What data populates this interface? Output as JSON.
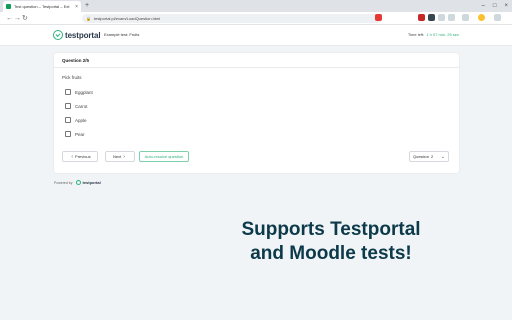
{
  "browser": {
    "tab_title": "Test question – Testportal – Ext",
    "tab_close": "×",
    "new_tab": "+",
    "window_buttons": [
      "–",
      "□",
      "×"
    ],
    "nav_icons": [
      "←",
      "→",
      "↻"
    ],
    "url": "testportal.pl/exam/LoadQuestion.html"
  },
  "header": {
    "logo_text": "testportal",
    "test_name": "Example test: Fruits",
    "time_label": "Time left:",
    "time_value": "1 h 07 min. 25 sec"
  },
  "question": {
    "title": "Question 2/5",
    "prompt": "Pick fruits",
    "options": [
      "Eggplant",
      "Carrot",
      "Apple",
      "Pear"
    ],
    "previous_label": "Previous",
    "next_label": "Next",
    "auto_label": "Auto-resolve question",
    "selector_label": "Question",
    "selector_value": "2"
  },
  "footer": {
    "powered_label": "Powered by",
    "powered_name": "testportal"
  },
  "promo": {
    "line1": "Supports Testportal",
    "line2": "and Moodle tests!"
  },
  "colors": {
    "accent": "#2ab27b",
    "promo_text": "#0c3a4b",
    "background": "#f1f4f6"
  }
}
